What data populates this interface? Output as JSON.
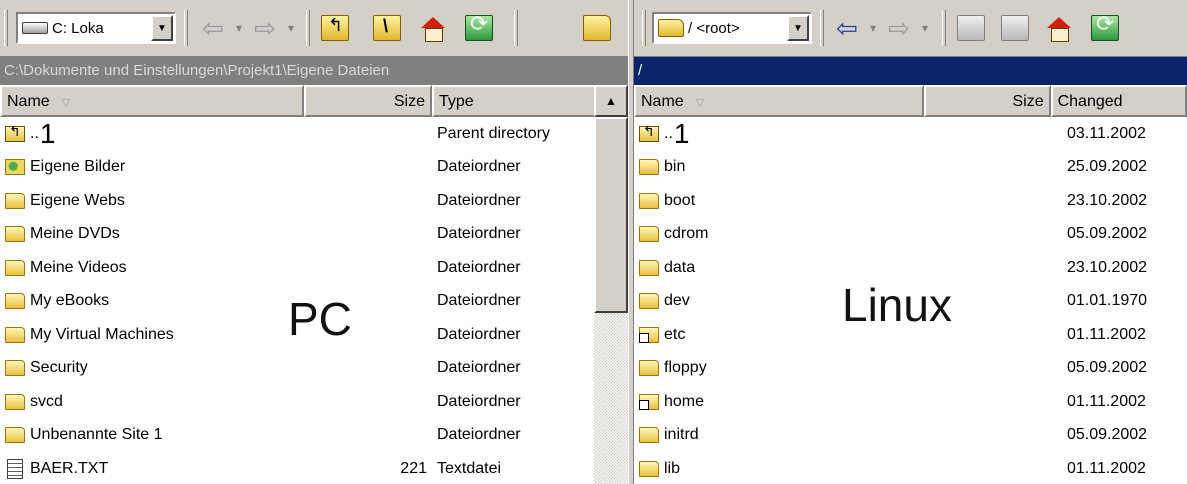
{
  "left": {
    "drive": "C: Loka",
    "path": "C:\\Dokumente und Einstellungen\\Projekt1\\Eigene Dateien",
    "columns": {
      "name": "Name",
      "size": "Size",
      "type": "Type"
    },
    "overlay_label": "PC",
    "parent_marker": "1",
    "rows": [
      {
        "name": "..",
        "size": "",
        "type": "Parent directory",
        "icon": "updir"
      },
      {
        "name": "Eigene Bilder",
        "size": "",
        "type": "Dateiordner",
        "icon": "pictures-folder"
      },
      {
        "name": "Eigene Webs",
        "size": "",
        "type": "Dateiordner",
        "icon": "folder"
      },
      {
        "name": "Meine DVDs",
        "size": "",
        "type": "Dateiordner",
        "icon": "folder"
      },
      {
        "name": "Meine Videos",
        "size": "",
        "type": "Dateiordner",
        "icon": "folder"
      },
      {
        "name": "My eBooks",
        "size": "",
        "type": "Dateiordner",
        "icon": "folder"
      },
      {
        "name": "My Virtual Machines",
        "size": "",
        "type": "Dateiordner",
        "icon": "folder"
      },
      {
        "name": "Security",
        "size": "",
        "type": "Dateiordner",
        "icon": "folder"
      },
      {
        "name": "svcd",
        "size": "",
        "type": "Dateiordner",
        "icon": "folder"
      },
      {
        "name": "Unbenannte Site 1",
        "size": "",
        "type": "Dateiordner",
        "icon": "folder"
      },
      {
        "name": "BAER.TXT",
        "size": "221",
        "type": "Textdatei",
        "icon": "text-file"
      }
    ]
  },
  "right": {
    "drive": "/ <root>",
    "path": "/",
    "columns": {
      "name": "Name",
      "size": "Size",
      "changed": "Changed"
    },
    "overlay_label": "Linux",
    "parent_marker": "1",
    "rows": [
      {
        "name": "..",
        "size": "",
        "changed": "03.11.2002",
        "icon": "updir"
      },
      {
        "name": "bin",
        "size": "",
        "changed": "25.09.2002",
        "icon": "folder"
      },
      {
        "name": "boot",
        "size": "",
        "changed": "23.10.2002",
        "icon": "folder"
      },
      {
        "name": "cdrom",
        "size": "",
        "changed": "05.09.2002",
        "icon": "folder"
      },
      {
        "name": "data",
        "size": "",
        "changed": "23.10.2002",
        "icon": "folder"
      },
      {
        "name": "dev",
        "size": "",
        "changed": "01.01.1970",
        "icon": "folder"
      },
      {
        "name": "etc",
        "size": "",
        "changed": "01.11.2002",
        "icon": "link-folder"
      },
      {
        "name": "floppy",
        "size": "",
        "changed": "05.09.2002",
        "icon": "folder"
      },
      {
        "name": "home",
        "size": "",
        "changed": "01.11.2002",
        "icon": "link-folder"
      },
      {
        "name": "initrd",
        "size": "",
        "changed": "05.09.2002",
        "icon": "folder"
      },
      {
        "name": "lib",
        "size": "",
        "changed": "01.11.2002",
        "icon": "folder"
      }
    ]
  }
}
